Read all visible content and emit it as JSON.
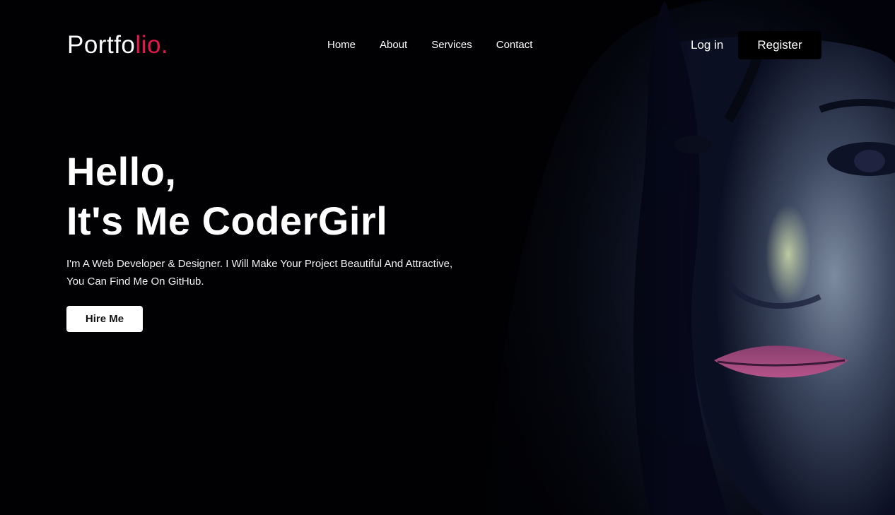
{
  "header": {
    "logo_main": "Portfo",
    "logo_accent": "lio.",
    "nav": [
      "Home",
      "About",
      "Services",
      "Contact"
    ],
    "login_label": "Log in",
    "register_label": "Register"
  },
  "hero": {
    "line1": "Hello,",
    "line2": "It's Me CoderGirl",
    "description_line1": "I'm A Web Developer & Designer. I Will Make Your Project Beautiful And Attractive,",
    "description_line2": "You Can Find Me On GitHub.",
    "hire_label": "Hire Me"
  },
  "colors": {
    "accent": "#e8154a",
    "background": "#010103"
  }
}
